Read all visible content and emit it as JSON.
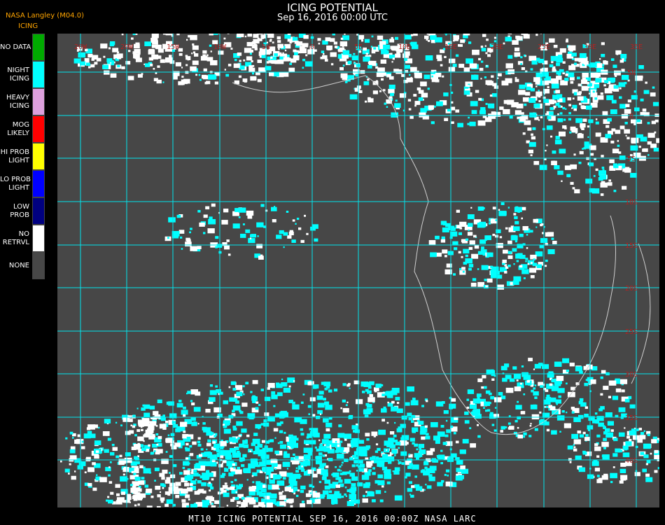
{
  "header": {
    "title": "ICING POTENTIAL",
    "datetime": "Sep 16, 2016 00:00 UTC",
    "source": "NASA Langley (M04.0)",
    "legend_title": "ICING"
  },
  "legend": [
    {
      "label": "NO DATA",
      "color": "#00aa00"
    },
    {
      "label": "NIGHT\nICING",
      "color": "#00ffff"
    },
    {
      "label": "HEAVY\nICING",
      "color": "#dda0dd"
    },
    {
      "label": "MOG\nLIKELY",
      "color": "#ff0000"
    },
    {
      "label": "HI PROB\nLIGHT",
      "color": "#ffff00"
    },
    {
      "label": "LO PROB\nLIGHT",
      "color": "#0000ff"
    },
    {
      "label": "LOW\nPROB",
      "color": "#000080"
    },
    {
      "label": "NO\nRETRVL",
      "color": "#ffffff"
    },
    {
      "label": "NONE",
      "color": "#474747"
    }
  ],
  "map": {
    "top_labels": [
      "20W",
      "20W",
      "15W",
      "10W",
      "5W",
      "0",
      "5E",
      "10E",
      "15E",
      "20E",
      "25E",
      "30E",
      "35E"
    ],
    "right_labels": [
      "5N",
      "0",
      "5S",
      "10S",
      "15S",
      "20S",
      "25S",
      "30S",
      "35S",
      "40S"
    ],
    "grid_color": "#00e5ee",
    "label_color": "#b22222"
  },
  "footer": "MT10   ICING POTENTIAL   SEP 16, 2016 00:00Z   NASA LARC"
}
